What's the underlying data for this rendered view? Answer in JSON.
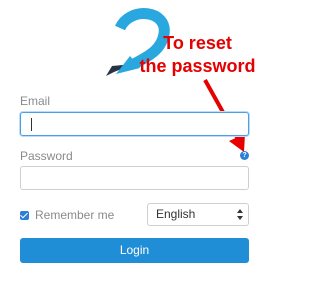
{
  "annotation": {
    "line1": "To reset",
    "line2": "the password"
  },
  "form": {
    "email_label": "Email",
    "email_value": "",
    "password_label": "Password",
    "password_value": "",
    "help_symbol": "?",
    "remember_label": "Remember me",
    "remember_checked": true,
    "language_selected": "English",
    "login_label": "Login"
  },
  "colors": {
    "accent": "#1f8ed6",
    "annotation": "#e60000",
    "logo_blue": "#29a8e0",
    "logo_dark": "#2a3342"
  },
  "icons": {
    "logo": "swoosh-pen-logo",
    "help": "question-circle-icon",
    "checkbox": "checkbox-checked-icon",
    "select": "select-updown-arrows-icon"
  }
}
